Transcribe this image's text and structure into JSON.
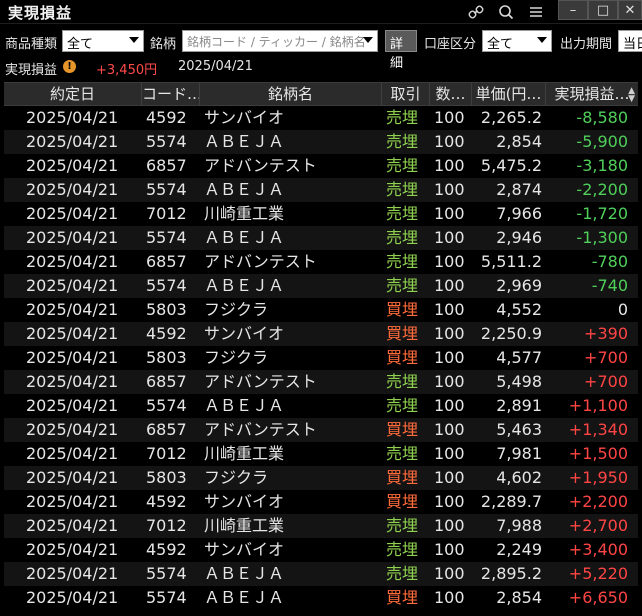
{
  "window": {
    "title": "実現損益",
    "icons": [
      "link-icon",
      "search-icon",
      "menu-icon"
    ],
    "controls": {
      "minimize": "–",
      "maximize": "□",
      "close": "✕"
    }
  },
  "filters": {
    "product_label": "商品種類",
    "product_value": "全て",
    "brand_label": "銘柄",
    "brand_placeholder": "銘柄コード / ティッカー / 銘柄名",
    "detail_button": "詳細",
    "account_label": "口座区分",
    "account_value": "全て",
    "period_label": "出力期間",
    "period_value": "当日"
  },
  "summary": {
    "label": "実現損益",
    "warning_icon": "!",
    "value": "+3,450円",
    "date": "2025/04/21"
  },
  "table": {
    "columns": [
      "約定日",
      "コード…",
      "銘柄名",
      "取引",
      "数…",
      "単価(円…",
      "実現損益…"
    ],
    "rows": [
      {
        "date": "2025/04/21",
        "code": "4592",
        "name": "サンバイオ",
        "side": "売埋",
        "qty": "100",
        "price": "2,265.2",
        "pnl": "-8,580"
      },
      {
        "date": "2025/04/21",
        "code": "5574",
        "name": "ＡＢＥＪＡ",
        "side": "売埋",
        "qty": "100",
        "price": "2,854",
        "pnl": "-5,900"
      },
      {
        "date": "2025/04/21",
        "code": "6857",
        "name": "アドバンテスト",
        "side": "売埋",
        "qty": "100",
        "price": "5,475.2",
        "pnl": "-3,180"
      },
      {
        "date": "2025/04/21",
        "code": "5574",
        "name": "ＡＢＥＪＡ",
        "side": "売埋",
        "qty": "100",
        "price": "2,874",
        "pnl": "-2,200"
      },
      {
        "date": "2025/04/21",
        "code": "7012",
        "name": "川崎重工業",
        "side": "売埋",
        "qty": "100",
        "price": "7,966",
        "pnl": "-1,720"
      },
      {
        "date": "2025/04/21",
        "code": "5574",
        "name": "ＡＢＥＪＡ",
        "side": "売埋",
        "qty": "100",
        "price": "2,946",
        "pnl": "-1,300"
      },
      {
        "date": "2025/04/21",
        "code": "6857",
        "name": "アドバンテスト",
        "side": "売埋",
        "qty": "100",
        "price": "5,511.2",
        "pnl": "-780"
      },
      {
        "date": "2025/04/21",
        "code": "5574",
        "name": "ＡＢＥＪＡ",
        "side": "売埋",
        "qty": "100",
        "price": "2,969",
        "pnl": "-740"
      },
      {
        "date": "2025/04/21",
        "code": "5803",
        "name": "フジクラ",
        "side": "買埋",
        "qty": "100",
        "price": "4,552",
        "pnl": "0"
      },
      {
        "date": "2025/04/21",
        "code": "4592",
        "name": "サンバイオ",
        "side": "買埋",
        "qty": "100",
        "price": "2,250.9",
        "pnl": "+390"
      },
      {
        "date": "2025/04/21",
        "code": "5803",
        "name": "フジクラ",
        "side": "買埋",
        "qty": "100",
        "price": "4,577",
        "pnl": "+700"
      },
      {
        "date": "2025/04/21",
        "code": "6857",
        "name": "アドバンテスト",
        "side": "売埋",
        "qty": "100",
        "price": "5,498",
        "pnl": "+700"
      },
      {
        "date": "2025/04/21",
        "code": "5574",
        "name": "ＡＢＥＪＡ",
        "side": "売埋",
        "qty": "100",
        "price": "2,891",
        "pnl": "+1,100"
      },
      {
        "date": "2025/04/21",
        "code": "6857",
        "name": "アドバンテスト",
        "side": "買埋",
        "qty": "100",
        "price": "5,463",
        "pnl": "+1,340"
      },
      {
        "date": "2025/04/21",
        "code": "7012",
        "name": "川崎重工業",
        "side": "売埋",
        "qty": "100",
        "price": "7,981",
        "pnl": "+1,500"
      },
      {
        "date": "2025/04/21",
        "code": "5803",
        "name": "フジクラ",
        "side": "買埋",
        "qty": "100",
        "price": "4,602",
        "pnl": "+1,950"
      },
      {
        "date": "2025/04/21",
        "code": "4592",
        "name": "サンバイオ",
        "side": "買埋",
        "qty": "100",
        "price": "2,289.7",
        "pnl": "+2,200"
      },
      {
        "date": "2025/04/21",
        "code": "7012",
        "name": "川崎重工業",
        "side": "売埋",
        "qty": "100",
        "price": "7,988",
        "pnl": "+2,700"
      },
      {
        "date": "2025/04/21",
        "code": "4592",
        "name": "サンバイオ",
        "side": "売埋",
        "qty": "100",
        "price": "2,249",
        "pnl": "+3,400"
      },
      {
        "date": "2025/04/21",
        "code": "5574",
        "name": "ＡＢＥＪＡ",
        "side": "売埋",
        "qty": "100",
        "price": "2,895.2",
        "pnl": "+5,220"
      },
      {
        "date": "2025/04/21",
        "code": "5574",
        "name": "ＡＢＥＪＡ",
        "side": "買埋",
        "qty": "100",
        "price": "2,854",
        "pnl": "+6,650"
      }
    ]
  },
  "colors": {
    "sell": "#8fd14f",
    "buy": "#ff6b3a",
    "profit": "#ff4545",
    "loss": "#4fd05a"
  }
}
